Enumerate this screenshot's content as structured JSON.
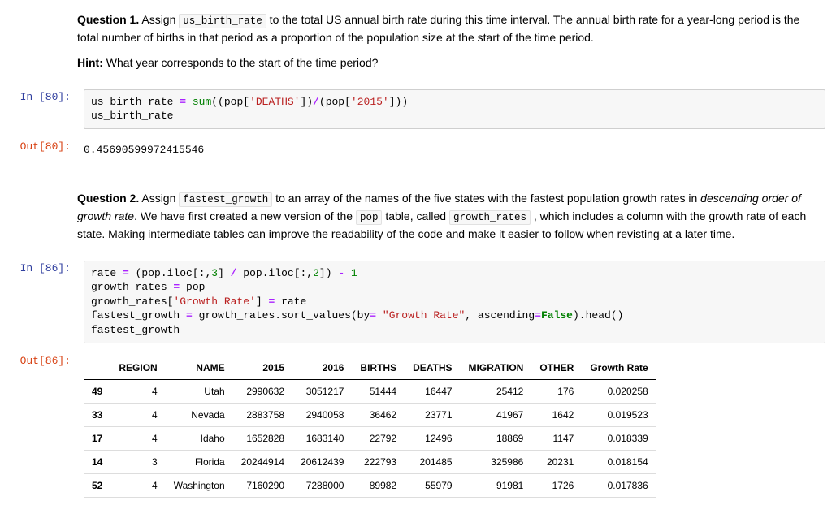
{
  "q1": {
    "label": "Question 1.",
    "text_before_code": " Assign ",
    "code1": "us_birth_rate",
    "text_after_code1": " to the total US annual birth rate during this time interval. The annual birth rate for a year-long period is the total number of births in that period as a proportion of the population size at the start of the time period.",
    "hint_label": "Hint:",
    "hint_text": " What year corresponds to the start of the time period?"
  },
  "cell80": {
    "in_label": "In [80]:",
    "out_label": "Out[80]:",
    "code": {
      "l1_a": "us_birth_rate ",
      "l1_op": "=",
      "l1_b": " ",
      "l1_fn": "sum",
      "l1_c": "((pop[",
      "l1_s1": "'DEATHS'",
      "l1_d": "])",
      "l1_op2": "/",
      "l1_e": "(pop[",
      "l1_s2": "'2015'",
      "l1_f": "]))",
      "l2": "us_birth_rate"
    },
    "output": "0.45690599972415546"
  },
  "q2": {
    "label": "Question 2.",
    "t1": " Assign ",
    "code1": "fastest_growth",
    "t2": " to an array of the names of the five states with the fastest population growth rates in ",
    "italic": "descending order of growth rate",
    "t3": ". We have first created a new version of the ",
    "code2": "pop",
    "t4": " table, called ",
    "code3": "growth_rates",
    "t5": " , which includes a column with the growth rate of each state. Making intermediate tables can improve the readability of the code and make it easier to follow when revisting at a later time."
  },
  "cell86": {
    "in_label": "In [86]:",
    "out_label": "Out[86]:",
    "code": {
      "l1_a": "rate ",
      "l1_op": "=",
      "l1_b": " (pop.iloc[:,",
      "l1_n1": "3",
      "l1_c": "] ",
      "l1_op2": "/",
      "l1_d": " pop.iloc[:,",
      "l1_n2": "2",
      "l1_e": "]) ",
      "l1_op3": "-",
      "l1_f": " ",
      "l1_n3": "1",
      "l2_a": "growth_rates ",
      "l2_op": "=",
      "l2_b": " pop",
      "l3_a": "growth_rates[",
      "l3_s1": "'Growth Rate'",
      "l3_b": "] ",
      "l3_op": "=",
      "l3_c": " rate",
      "l4_a": "fastest_growth ",
      "l4_op": "=",
      "l4_b": " growth_rates.sort_values(by",
      "l4_op2": "=",
      "l4_c": " ",
      "l4_s1": "\"Growth Rate\"",
      "l4_d": ", ascending",
      "l4_op3": "=",
      "l4_kw": "False",
      "l4_e": ").head()",
      "l5": "fastest_growth"
    }
  },
  "table": {
    "headers": [
      "",
      "REGION",
      "NAME",
      "2015",
      "2016",
      "BIRTHS",
      "DEATHS",
      "MIGRATION",
      "OTHER",
      "Growth Rate"
    ],
    "rows": [
      [
        "49",
        "4",
        "Utah",
        "2990632",
        "3051217",
        "51444",
        "16447",
        "25412",
        "176",
        "0.020258"
      ],
      [
        "33",
        "4",
        "Nevada",
        "2883758",
        "2940058",
        "36462",
        "23771",
        "41967",
        "1642",
        "0.019523"
      ],
      [
        "17",
        "4",
        "Idaho",
        "1652828",
        "1683140",
        "22792",
        "12496",
        "18869",
        "1147",
        "0.018339"
      ],
      [
        "14",
        "3",
        "Florida",
        "20244914",
        "20612439",
        "222793",
        "201485",
        "325986",
        "20231",
        "0.018154"
      ],
      [
        "52",
        "4",
        "Washington",
        "7160290",
        "7288000",
        "89982",
        "55979",
        "91981",
        "1726",
        "0.017836"
      ]
    ]
  }
}
